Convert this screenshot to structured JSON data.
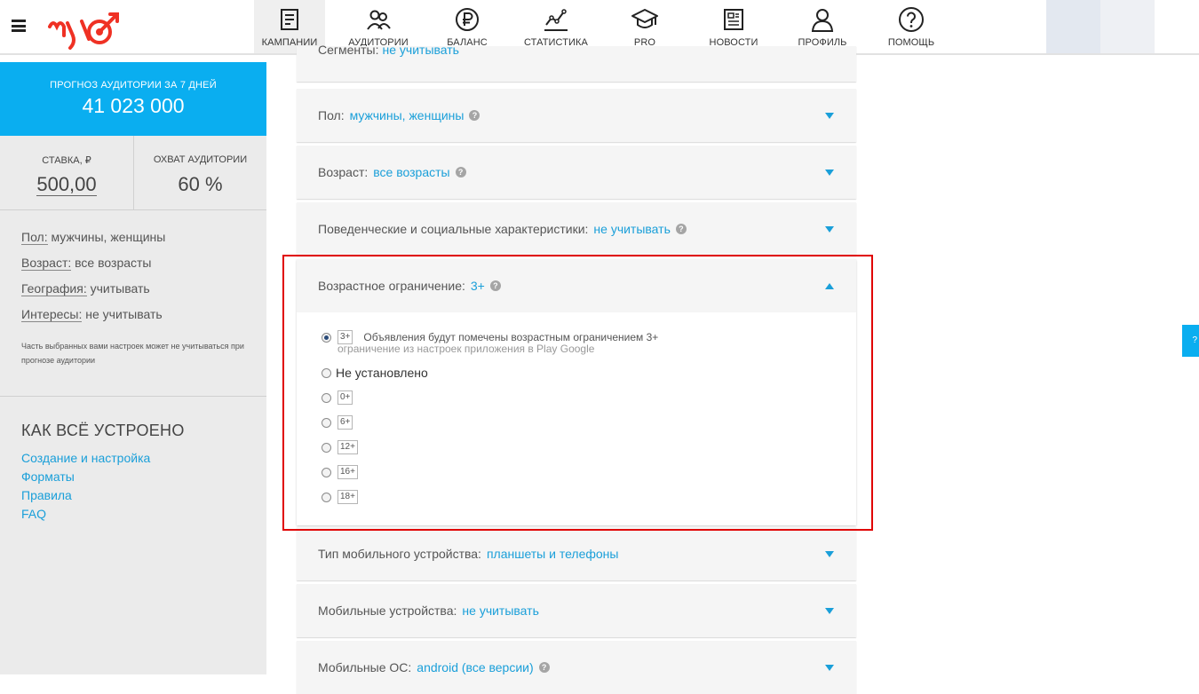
{
  "nav": {
    "items": [
      {
        "label": "КАМПАНИИ",
        "icon": "campaigns-icon",
        "active": true
      },
      {
        "label": "АУДИТОРИИ",
        "icon": "audiences-icon",
        "active": false
      },
      {
        "label": "БАЛАНС",
        "icon": "ruble-icon",
        "active": false
      },
      {
        "label": "СТАТИСТИКА",
        "icon": "chart-icon",
        "active": false
      },
      {
        "label": "PRO",
        "icon": "graduation-cap-icon",
        "active": false
      },
      {
        "label": "НОВОСТИ",
        "icon": "newspaper-icon",
        "active": false
      },
      {
        "label": "ПРОФИЛЬ",
        "icon": "profile-icon",
        "active": false
      },
      {
        "label": "ПОМОЩЬ",
        "icon": "help-icon",
        "active": false
      }
    ]
  },
  "brand": {
    "accent": "#0aaef0",
    "logo_color": "#ef3124",
    "link": "#1a9fd9",
    "highlight": "#e00000"
  },
  "sidebar": {
    "forecast_label": "ПРОГНОЗ АУДИТОРИИ ЗА 7 ДНЕЙ",
    "forecast_value": "41 023 000",
    "bid_label": "СТАВКА, ₽",
    "bid_value": "500,00",
    "reach_label": "ОХВАТ АУДИТОРИИ",
    "reach_value": "60 %",
    "summary": [
      {
        "key": "Пол:",
        "value": "мужчины, женщины"
      },
      {
        "key": "Возраст:",
        "value": "все возрасты"
      },
      {
        "key": "География:",
        "value": "учитывать"
      },
      {
        "key": "Интересы:",
        "value": "не учитывать"
      }
    ],
    "note": "Часть выбранных вами настроек может не учитываться при прогнозе аудитории",
    "howto_title": "КАК ВСЁ УСТРОЕНО",
    "links": [
      "Создание и настройка",
      "Форматы",
      "Правила",
      "FAQ"
    ]
  },
  "panels": {
    "top_cut": {
      "key": "Сегменты:",
      "value": "не учитывать"
    },
    "gender": {
      "key": "Пол:",
      "value": "мужчины, женщины"
    },
    "age": {
      "key": "Возраст:",
      "value": "все возрасты"
    },
    "behavior": {
      "key": "Поведенческие и социальные характеристики:",
      "value": "не учитывать"
    },
    "age_limit": {
      "key": "Возрастное ограничение:",
      "value": "3+",
      "options": [
        {
          "badge": "3+",
          "text": "Объявления будут помечены возрастным ограничением 3+",
          "sub": "ограничение из настроек приложения в Play Google",
          "selected": true
        },
        {
          "text": "Не установлено",
          "selected": false
        },
        {
          "badge": "0+",
          "selected": false
        },
        {
          "badge": "6+",
          "selected": false
        },
        {
          "badge": "12+",
          "selected": false
        },
        {
          "badge": "16+",
          "selected": false
        },
        {
          "badge": "18+",
          "selected": false
        }
      ]
    },
    "device_type": {
      "key": "Тип мобильного устройства:",
      "value": "планшеты и телефоны"
    },
    "devices": {
      "key": "Мобильные устройства:",
      "value": "не учитывать"
    },
    "os": {
      "key": "Мобильные ОС:",
      "value": "android (все версии)"
    }
  },
  "side_tab": "?"
}
